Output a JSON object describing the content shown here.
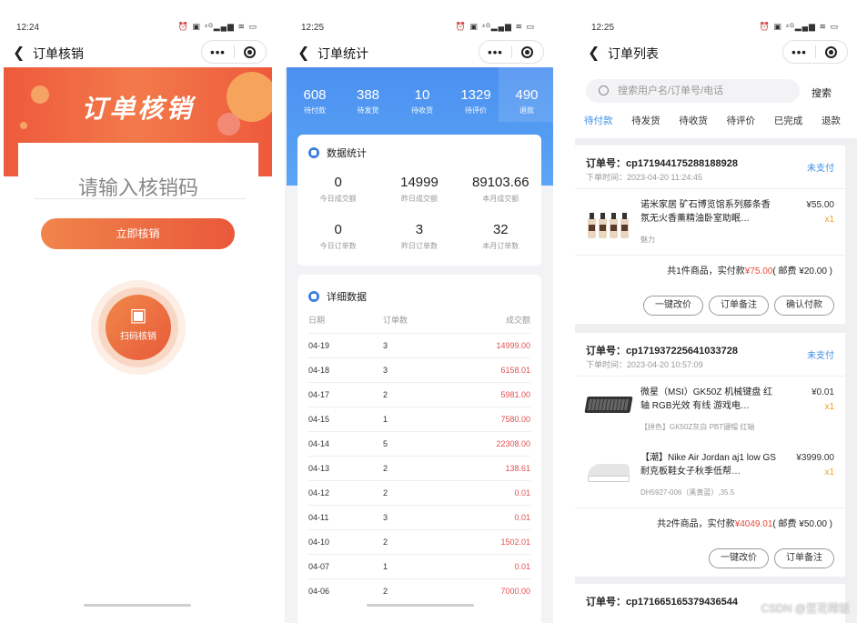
{
  "phone1": {
    "time": "12:24",
    "status_icons": "⏰ ▣ ⁴ᴳ▂▄▆ ≋ ▭",
    "title": "订单核销",
    "banner_title": "订单核销",
    "input_placeholder": "请输入核销码",
    "verify_button": "立即核销",
    "scan_label": "扫码核销",
    "scan_icon": "qr-code-icon"
  },
  "phone2": {
    "time": "12:25",
    "status_icons": "⏰ ▣ ⁴ᴳ▂▄▆ ≋ ▭",
    "title": "订单统计",
    "top_stats": [
      {
        "value": "608",
        "label": "待付款"
      },
      {
        "value": "388",
        "label": "待发货"
      },
      {
        "value": "10",
        "label": "待收货"
      },
      {
        "value": "1329",
        "label": "待评价"
      },
      {
        "value": "490",
        "label": "退款"
      }
    ],
    "data_title": "数据统计",
    "data_stats": [
      {
        "value": "0",
        "label": "今日成交额"
      },
      {
        "value": "14999",
        "label": "昨日成交额"
      },
      {
        "value": "89103.66",
        "label": "本月成交额"
      },
      {
        "value": "0",
        "label": "今日订单数"
      },
      {
        "value": "3",
        "label": "昨日订单数"
      },
      {
        "value": "32",
        "label": "本月订单数"
      }
    ],
    "detail_title": "详细数据",
    "detail_headers": [
      "日期",
      "订单数",
      "成交额"
    ],
    "detail_rows": [
      [
        "04-19",
        "3",
        "14999.00"
      ],
      [
        "04-18",
        "3",
        "6158.01"
      ],
      [
        "04-17",
        "2",
        "5981.00"
      ],
      [
        "04-15",
        "1",
        "7580.00"
      ],
      [
        "04-14",
        "5",
        "22308.00"
      ],
      [
        "04-13",
        "2",
        "138.61"
      ],
      [
        "04-12",
        "2",
        "0.01"
      ],
      [
        "04-11",
        "3",
        "0.01"
      ],
      [
        "04-10",
        "2",
        "1502.01"
      ],
      [
        "04-07",
        "1",
        "0.01"
      ],
      [
        "04-06",
        "2",
        "7000.00"
      ]
    ]
  },
  "phone3": {
    "time": "12:25",
    "status_icons": "⏰ ▣ ⁴ᴳ▂▄▆ ≋ ▭",
    "title": "订单列表",
    "search_placeholder": "搜索用户名/订单号/电话",
    "search_button": "搜索",
    "tabs": [
      "待付款",
      "待发货",
      "待收货",
      "待评价",
      "已完成",
      "退款"
    ],
    "orders": [
      {
        "no": "订单号：cp171944175288188928",
        "time": "下单时间：2023-04-20 11:24:45",
        "status": "未支付",
        "items": [
          {
            "name": "诺米家居 矿石博览馆系列藤条香氛无火香薰精油卧室助眠…",
            "spec": "魅力",
            "price": "¥55.00",
            "qty": "x1"
          }
        ],
        "summary_prefix": "共1件商品，实付款",
        "summary_amount": "¥75.00",
        "summary_suffix": "( 邮费 ¥20.00 )",
        "buttons": [
          "一键改价",
          "订单备注",
          "确认付款"
        ]
      },
      {
        "no": "订单号：cp171937225641033728",
        "time": "下单时间：2023-04-20 10:57:09",
        "status": "未支付",
        "items": [
          {
            "name": "微星（MSI）GK50Z 机械键盘 红轴 RGB光效 有线 游戏电…",
            "spec": "【拼色】GK50Z灰白 PBT键帽 红轴",
            "price": "¥0.01",
            "qty": "x1"
          },
          {
            "name": "【潮】Nike Air Jordan aj1 low GS耐克板鞋女子秋季低帮…",
            "spec": "DH5927-006（黑黄蓝）,35.5",
            "price": "¥3999.00",
            "qty": "x1"
          }
        ],
        "summary_prefix": "共2件商品，实付款",
        "summary_amount": "¥4049.01",
        "summary_suffix": "( 邮费 ¥50.00 )",
        "buttons": [
          "一键改价",
          "订单备注"
        ]
      },
      {
        "no": "订单号：cp171665165379436544"
      }
    ],
    "watermark": "CSDN @豆花稀饭"
  },
  "colors": {
    "accent_orange": "#ee5a3c",
    "accent_blue": "#3a8ee8",
    "price_red": "#e84a3a",
    "qty_orange": "#f0a020"
  }
}
